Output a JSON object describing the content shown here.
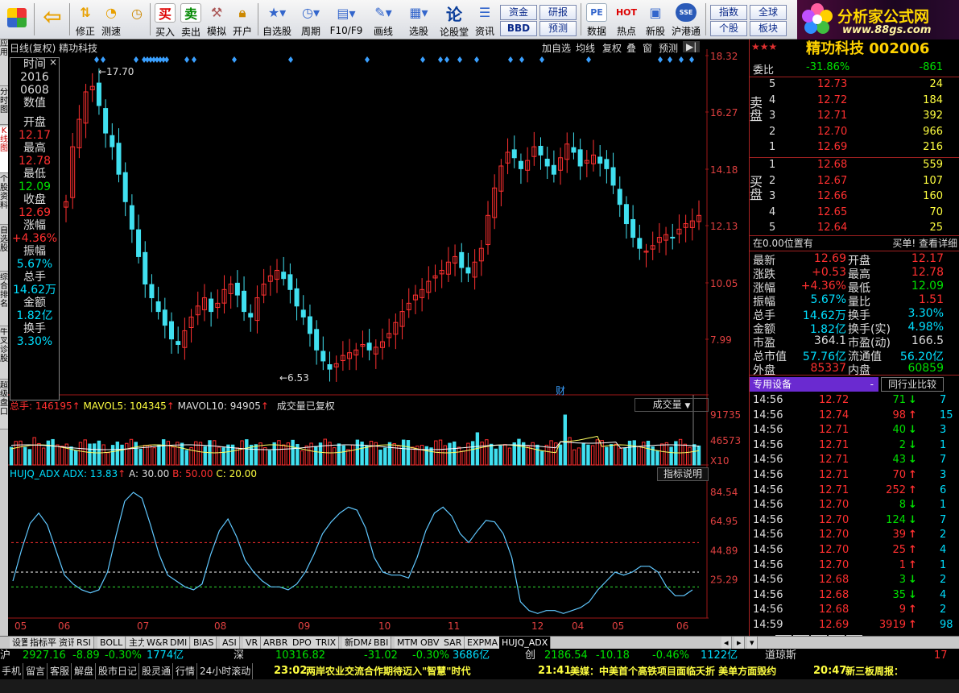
{
  "toolbar": {
    "buttons": [
      {
        "label": "",
        "icon": "window-icon"
      },
      {
        "label": "",
        "icon": "back-arrow-icon"
      },
      {
        "label": "修正",
        "icon": "up-down-arrow-icon"
      },
      {
        "label": "测速",
        "icon": "speed-icon"
      },
      {
        "label": "买入",
        "icon": "buy-icon",
        "glyph": "买"
      },
      {
        "label": "卖出",
        "icon": "sell-icon",
        "glyph": "卖"
      },
      {
        "label": "模拟",
        "icon": "hammer-icon"
      },
      {
        "label": "开户",
        "icon": "lock-icon"
      },
      {
        "label": "自选股",
        "icon": "star-window-icon"
      },
      {
        "label": "周期",
        "icon": "clock-icon"
      },
      {
        "label": "F10/F9",
        "icon": "f10-icon"
      },
      {
        "label": "画线",
        "icon": "pen-icon"
      },
      {
        "label": "选股",
        "icon": "filter-icon"
      },
      {
        "label": "论股堂",
        "icon": "talk-icon",
        "glyph": "论"
      },
      {
        "label": "资讯",
        "icon": "news-icon"
      },
      {
        "label": "数据",
        "icon": "pe-icon",
        "glyph": "PE"
      },
      {
        "label": "热点",
        "icon": "hot-icon"
      },
      {
        "label": "新股",
        "icon": "new-stock-icon"
      },
      {
        "label": "沪港通",
        "icon": "sse-hke-icon"
      }
    ],
    "small_buttons": [
      "资金",
      "研报",
      "BBD",
      "预测",
      "指数",
      "全球",
      "个股",
      "板块"
    ]
  },
  "logo": {
    "title": "分析家公式网",
    "url_text": "www.88gs.com"
  },
  "left_tabs": [
    "应用",
    "分时图",
    "K线图",
    "个股资料",
    "自选股",
    "综合排名",
    "牛叉诊股",
    "超级盘口"
  ],
  "chart": {
    "title": "日线(复权)  精功科技",
    "right_tools": [
      "加自选",
      "均线",
      "复权",
      "叠",
      "窗",
      "预测"
    ],
    "y_labels": [
      "18.32",
      "16.27",
      "14.18",
      "12.13",
      "10.05",
      "7.99"
    ],
    "high_label": "17.70",
    "low_label": "6.53",
    "cai_marker": "财",
    "info": {
      "time_label": "时间",
      "date1": "2016",
      "date2": "0608",
      "value_label": "数值",
      "open_label": "开盘",
      "open": "12.17",
      "high_label": "最高",
      "high": "12.78",
      "low_label": "最低",
      "low": "12.09",
      "close_label": "收盘",
      "close": "12.69",
      "chg_label": "涨幅",
      "chg": "+4.36%",
      "amp_label": "振幅",
      "amp": "5.67%",
      "vol_label": "总手",
      "vol": "14.62万",
      "amt_label": "金额",
      "amt": "1.82亿",
      "turn_label": "换手",
      "turn": "3.30%"
    },
    "volume": {
      "header_vol": "总手: 146195",
      "mavol5": "MAVOL5: 104345",
      "mavol10": "MAVOL10: 94905",
      "note": "成交量已复权",
      "selector": "成交量",
      "y_labels": [
        "91735",
        "46573",
        "X10"
      ]
    },
    "indicator": {
      "name": "HUJQ_ADX ADX: 13.83",
      "a": "A: 30.00",
      "b": "B: 50.00",
      "c": "C: 20.00",
      "help": "指标说明",
      "y_labels": [
        "84.54",
        "64.95",
        "44.89",
        "25.29"
      ]
    },
    "x_labels": [
      "05",
      "06",
      "07",
      "08",
      "09",
      "10",
      "11",
      "12",
      "04",
      "05",
      "06"
    ]
  },
  "chart_data": {
    "type": "line",
    "title": "",
    "series": [
      {
        "name": "ADX",
        "values": [
          24,
          45,
          63,
          70,
          62,
          45,
          28,
          22,
          18,
          16,
          18,
          30,
          55,
          78,
          84,
          80,
          62,
          42,
          28,
          24,
          20,
          18,
          22,
          42,
          58,
          66,
          54,
          38,
          30,
          24,
          20,
          20,
          18,
          22,
          30,
          42,
          56,
          64,
          70,
          74,
          72,
          60,
          40,
          30,
          28,
          28,
          26,
          40,
          58,
          70,
          74,
          68,
          56,
          50,
          58,
          65,
          64,
          56,
          40,
          10,
          4,
          2,
          4,
          4,
          2,
          4,
          6,
          10,
          18,
          24,
          30,
          28,
          30,
          34,
          34,
          30,
          20,
          14,
          14,
          18
        ]
      }
    ],
    "ylim": [
      0,
      90
    ],
    "reference_lines": [
      50,
      30,
      20
    ]
  },
  "right_panel": {
    "stock_name": "精功科技 002006",
    "weibi_label": "委比",
    "weibi": "-31.86%",
    "weicha": "-861",
    "sell_label": "卖盘",
    "sell": [
      {
        "n": "5",
        "p": "12.73",
        "v": "24"
      },
      {
        "n": "4",
        "p": "12.72",
        "v": "184"
      },
      {
        "n": "3",
        "p": "12.71",
        "v": "392"
      },
      {
        "n": "2",
        "p": "12.70",
        "v": "966"
      },
      {
        "n": "1",
        "p": "12.69",
        "v": "216"
      }
    ],
    "buy_label": "买盘",
    "buy": [
      {
        "n": "1",
        "p": "12.68",
        "v": "559"
      },
      {
        "n": "2",
        "p": "12.67",
        "v": "107"
      },
      {
        "n": "3",
        "p": "12.66",
        "v": "160"
      },
      {
        "n": "4",
        "p": "12.65",
        "v": "70"
      },
      {
        "n": "5",
        "p": "12.64",
        "v": "25"
      }
    ],
    "pos_text": "在0.00位置有",
    "buy_hint": "买单! 查看详细",
    "stats": [
      {
        "l1": "最新",
        "v1": "12.69",
        "c1": "r",
        "l2": "开盘",
        "v2": "12.17",
        "c2": "r"
      },
      {
        "l1": "涨跌",
        "v1": "+0.53",
        "c1": "r",
        "l2": "最高",
        "v2": "12.78",
        "c2": "r"
      },
      {
        "l1": "涨幅",
        "v1": "+4.36%",
        "c1": "r",
        "l2": "最低",
        "v2": "12.09",
        "c2": "g"
      },
      {
        "l1": "振幅",
        "v1": "5.67%",
        "c1": "c",
        "l2": "量比",
        "v2": "1.51",
        "c2": "r"
      },
      {
        "l1": "总手",
        "v1": "14.62万",
        "c1": "c",
        "l2": "换手",
        "v2": "3.30%",
        "c2": "c"
      },
      {
        "l1": "金额",
        "v1": "1.82亿",
        "c1": "c",
        "l2": "换手(实)",
        "v2": "4.98%",
        "c2": "c"
      },
      {
        "l1": "市盈",
        "v1": "364.1",
        "c1": "w",
        "l2": "市盈(动)",
        "v2": "166.5",
        "c2": "w"
      },
      {
        "l1": "总市值",
        "v1": "57.76亿",
        "c1": "c",
        "l2": "流通值",
        "v2": "56.20亿",
        "c2": "c"
      },
      {
        "l1": "外盘",
        "v1": "85337",
        "c1": "r",
        "l2": "内盘",
        "v2": "60859",
        "c2": "g"
      }
    ],
    "special_label": "专用设备",
    "peer_label": "同行业比较",
    "ticks": [
      {
        "t": "14:56",
        "p": "12.72",
        "v": "71",
        "d": "down",
        "x": "7"
      },
      {
        "t": "14:56",
        "p": "12.74",
        "v": "98",
        "d": "up",
        "x": "15"
      },
      {
        "t": "14:56",
        "p": "12.71",
        "v": "40",
        "d": "down",
        "x": "3"
      },
      {
        "t": "14:56",
        "p": "12.71",
        "v": "2",
        "d": "down",
        "x": "1"
      },
      {
        "t": "14:56",
        "p": "12.71",
        "v": "43",
        "d": "down",
        "x": "7"
      },
      {
        "t": "14:56",
        "p": "12.71",
        "v": "70",
        "d": "up",
        "x": "3"
      },
      {
        "t": "14:56",
        "p": "12.71",
        "v": "252",
        "d": "up",
        "x": "6"
      },
      {
        "t": "14:56",
        "p": "12.70",
        "v": "8",
        "d": "down",
        "x": "1"
      },
      {
        "t": "14:56",
        "p": "12.70",
        "v": "124",
        "d": "down",
        "x": "7"
      },
      {
        "t": "14:56",
        "p": "12.70",
        "v": "39",
        "d": "up",
        "x": "2"
      },
      {
        "t": "14:56",
        "p": "12.70",
        "v": "25",
        "d": "up",
        "x": "4"
      },
      {
        "t": "14:56",
        "p": "12.70",
        "v": "1",
        "d": "up",
        "x": "1"
      },
      {
        "t": "14:56",
        "p": "12.68",
        "v": "3",
        "d": "down",
        "x": "2"
      },
      {
        "t": "14:56",
        "p": "12.68",
        "v": "35",
        "d": "down",
        "x": "4"
      },
      {
        "t": "14:56",
        "p": "12.68",
        "v": "9",
        "d": "up",
        "x": "2"
      },
      {
        "t": "14:59",
        "p": "12.69",
        "v": "3919",
        "d": "up",
        "x": "98"
      }
    ],
    "bottom_tabs": [
      "细",
      "诊",
      "分",
      "筹",
      "值",
      "财"
    ]
  },
  "bottom_tabs": [
    "设置",
    "指标平台",
    "资讯",
    "RSI",
    "BOLL",
    "主力",
    "W&R",
    "DMI",
    "BIAS",
    "ASI",
    "VR",
    "ARBR",
    "DPO",
    "TRIX",
    "新DMA",
    "BBI",
    "MTM",
    "OBV",
    "SAR",
    "EXPMA",
    "HUJQ_ADX"
  ],
  "status": {
    "line1": [
      {
        "text": "沪",
        "c": "w"
      },
      {
        "text": "2927.16",
        "c": "g"
      },
      {
        "text": "-8.89",
        "c": "g"
      },
      {
        "text": "-0.30%",
        "c": "g"
      },
      {
        "text": "1774亿",
        "c": "c"
      },
      {
        "text": "深",
        "c": "w"
      },
      {
        "text": "10316.82",
        "c": "g"
      },
      {
        "text": "-31.02",
        "c": "g"
      },
      {
        "text": "-0.30%",
        "c": "g"
      },
      {
        "text": "3686亿",
        "c": "c"
      },
      {
        "text": "创",
        "c": "w"
      },
      {
        "text": "2186.54",
        "c": "g"
      },
      {
        "text": "-10.18",
        "c": "g"
      },
      {
        "text": "-0.46%",
        "c": "g"
      },
      {
        "text": "1122亿",
        "c": "c"
      },
      {
        "text": "道琼斯",
        "c": "w"
      },
      {
        "text": "17",
        "c": "r"
      }
    ],
    "line2_left": [
      "手机",
      "留言",
      "客服",
      "解盘",
      "股市日记",
      "股灵通",
      "行情",
      "24小时滚动"
    ],
    "news": [
      {
        "time": "23:02",
        "text": "两岸农业交流合作期待迈入\"智慧\"时代"
      },
      {
        "time": "21:41",
        "text": "美媒：中美首个高铁项目面临夭折 美单方面毁约"
      },
      {
        "time": "20:47",
        "text": "新三板周报："
      }
    ]
  }
}
